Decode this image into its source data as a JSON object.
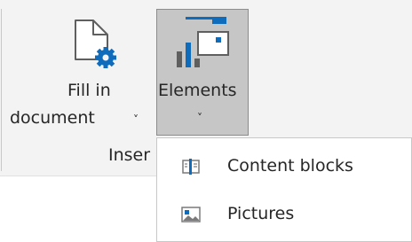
{
  "ribbon": {
    "fill_in_document": {
      "label_line1": "Fill in",
      "label_line2": "document",
      "chevron": "˅",
      "icon": "document-gear-icon"
    },
    "elements": {
      "label": "Elements",
      "chevron": "˅",
      "icon": "elements-icon",
      "state": "pressed"
    },
    "group_label": "Inser"
  },
  "menu": {
    "items": [
      {
        "label": "Content blocks",
        "icon": "content-blocks-icon"
      },
      {
        "label": "Pictures",
        "icon": "picture-icon"
      }
    ]
  },
  "colors": {
    "ribbon_background": "#f3f3f3",
    "pressed_button_background": "#c6c6c6",
    "accent_blue": "#0f6cbd",
    "text": "#262626"
  }
}
